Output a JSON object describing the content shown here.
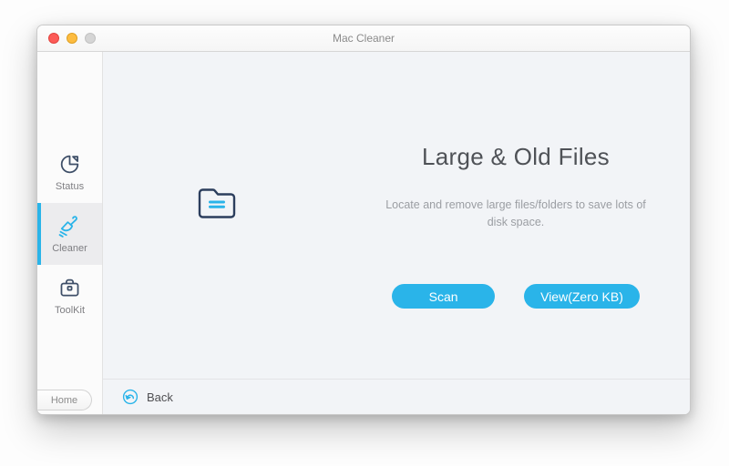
{
  "window": {
    "title": "Mac Cleaner",
    "traffic_lights": {
      "close": "#fc5b57",
      "minimize": "#fdbc40",
      "zoom_disabled": "#d5d5d5"
    }
  },
  "sidebar": {
    "items": [
      {
        "label": "Status",
        "icon": "pie-chart-icon",
        "selected": false
      },
      {
        "label": "Cleaner",
        "icon": "brush-icon",
        "selected": true
      },
      {
        "label": "ToolKit",
        "icon": "briefcase-icon",
        "selected": false
      }
    ],
    "home_tab": {
      "label": "Home"
    }
  },
  "main": {
    "heading": "Large & Old Files",
    "description": "Locate and remove large files/folders to save lots of disk space.",
    "center_icon": "folder-icon",
    "buttons": [
      {
        "label": "Scan"
      },
      {
        "label": "View(Zero KB)"
      }
    ],
    "footer": {
      "back_label": "Back",
      "back_icon": "back-arrow-icon"
    }
  },
  "colors": {
    "accent_cyan": "#2ab4e9",
    "icon_navy": "#3e4f68",
    "main_background": "#f2f4f7",
    "sidebar_background": "#fbfbfb",
    "selected_item_background": "#ececee"
  }
}
